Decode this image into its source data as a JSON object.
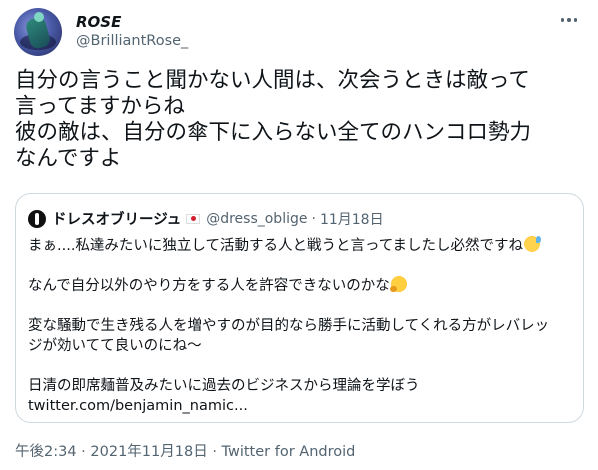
{
  "author": {
    "name": "ROSE",
    "handle": "@BrilliantRose_"
  },
  "tweet": {
    "lines": [
      "自分の言うこと聞かない人間は、次会うときは敵って",
      "言ってますからね",
      "彼の敵は、自分の傘下に入らない全てのハンコロ勢力",
      "なんですよ"
    ]
  },
  "quote": {
    "name": "ドレスオブリージュ",
    "handle": "@dress_oblige",
    "separator": "·",
    "date": "11月18日",
    "lines": {
      "l1": "まぁ....私達みたいに独立して活動する人と戦うと言ってましたし必然ですね",
      "l2": "なんで自分以外のやり方をする人を許容できないのかな",
      "l3": "変な騒動で生き残る人を増やすのが目的なら勝手に活動してくれる方がレバレッ",
      "l4": "ジが効いてて良いのにね～",
      "l5": "日清の即席麺普及みたいに過去のビジネスから理論を学ぼう",
      "link": "twitter.com/benjamin_namic..."
    },
    "emojis": [
      "sweat-smile-emoji",
      "thinking-face-emoji"
    ]
  },
  "footer": {
    "timestamp": "午後2:34 · 2021年11月18日",
    "separator": "·",
    "source": "Twitter for Android"
  },
  "colors": {
    "text": "#0f1419",
    "secondary": "#536471",
    "border": "#cfd9de"
  }
}
